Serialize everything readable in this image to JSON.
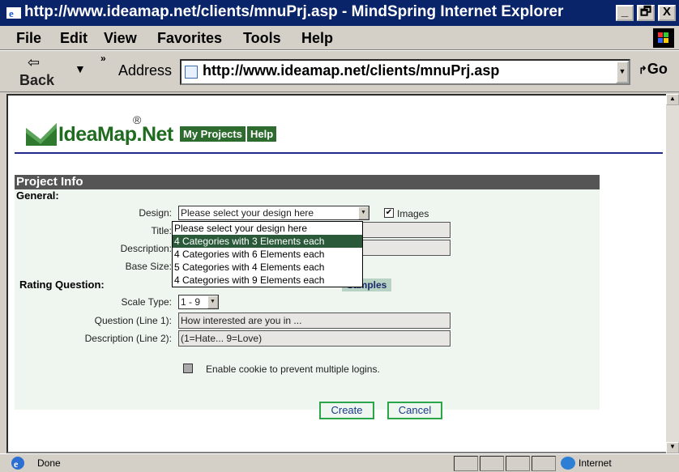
{
  "window": {
    "title": "http://www.ideamap.net/clients/mnuPrj.asp - MindSpring Internet Explorer",
    "minimize": "_",
    "maximize": "🗗",
    "close": "X"
  },
  "menu": {
    "items": [
      {
        "label": "File"
      },
      {
        "label": "Edit"
      },
      {
        "label": "View"
      },
      {
        "label": "Favorites"
      },
      {
        "label": "Tools"
      },
      {
        "label": "Help"
      }
    ]
  },
  "toolbar": {
    "back_label": "Back",
    "back_arrow": "⇦",
    "back_dropdown": "▼",
    "chevron": "»",
    "address_label": "Address",
    "url": "http://www.ideamap.net/clients/mnuPrj.asp",
    "go_label": "Go"
  },
  "site": {
    "logo_text": "IdeaMap.Net",
    "logo_reg": "®",
    "nav": [
      "My Projects",
      "Help"
    ]
  },
  "form": {
    "section_title": "Project Info",
    "general_label": "General:",
    "design_label": "Design:",
    "design_value": "Please select your design here",
    "images_label": "Images",
    "images_checked": true,
    "title_label": "Title:",
    "description_label": "Description:",
    "base_size_label": "Base Size:",
    "design_options": [
      "Please select your design here",
      "4 Categories with 3 Elements each",
      "4 Categories with 6 Elements each",
      "5 Categories with 4 Elements each",
      "4 Categories with 9 Elements each"
    ],
    "highlighted_option_index": 1,
    "samples_label": "Samples",
    "rating_label": "Rating Question:",
    "scale_type_label": "Scale Type:",
    "scale_type_value": "1 - 9",
    "question_label": "Question (Line 1):",
    "question_value": "How interested are you in ...",
    "desc2_label": "Description (Line 2):",
    "desc2_value": "(1=Hate... 9=Love)",
    "cookie_label": "Enable cookie to prevent multiple logins.",
    "create_label": "Create",
    "cancel_label": "Cancel"
  },
  "status": {
    "text": "Done",
    "zone": "Internet"
  }
}
